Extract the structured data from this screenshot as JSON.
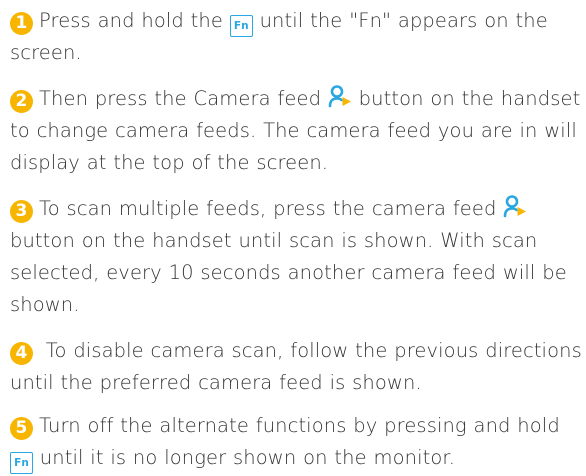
{
  "colors": {
    "accent": "#f7b500",
    "icon": "#2aa7e0",
    "text": "#333333"
  },
  "steps": [
    {
      "number": "1",
      "segments": [
        {
          "type": "text",
          "value": "Press and hold the "
        },
        {
          "type": "fn",
          "value": "Fn"
        },
        {
          "type": "text",
          "value": " until the \"Fn\" appears on the screen."
        }
      ]
    },
    {
      "number": "2",
      "segments": [
        {
          "type": "text",
          "value": "Then press the Camera feed "
        },
        {
          "type": "cam",
          "icon": "camera-feed-icon"
        },
        {
          "type": "text",
          "value": " button on the handset to change camera feeds. The camera feed you are in will display at the top of the screen."
        }
      ]
    },
    {
      "number": "3",
      "segments": [
        {
          "type": "text",
          "value": "To scan multiple feeds, press the camera feed "
        },
        {
          "type": "cam",
          "icon": "camera-feed-icon"
        },
        {
          "type": "text",
          "value": " button on the handset until scan is shown. With scan selected, every 10 seconds another camera feed will be shown."
        }
      ]
    },
    {
      "number": "4",
      "segments": [
        {
          "type": "text",
          "value": " To disable camera scan, follow the previous directions until the preferred camera feed is shown."
        }
      ]
    },
    {
      "number": "5",
      "segments": [
        {
          "type": "text",
          "value": "Turn off the alternate functions by pressing and hold "
        },
        {
          "type": "fn",
          "value": "Fn"
        },
        {
          "type": "text",
          "value": " until it is no longer shown on the monitor."
        }
      ]
    }
  ]
}
